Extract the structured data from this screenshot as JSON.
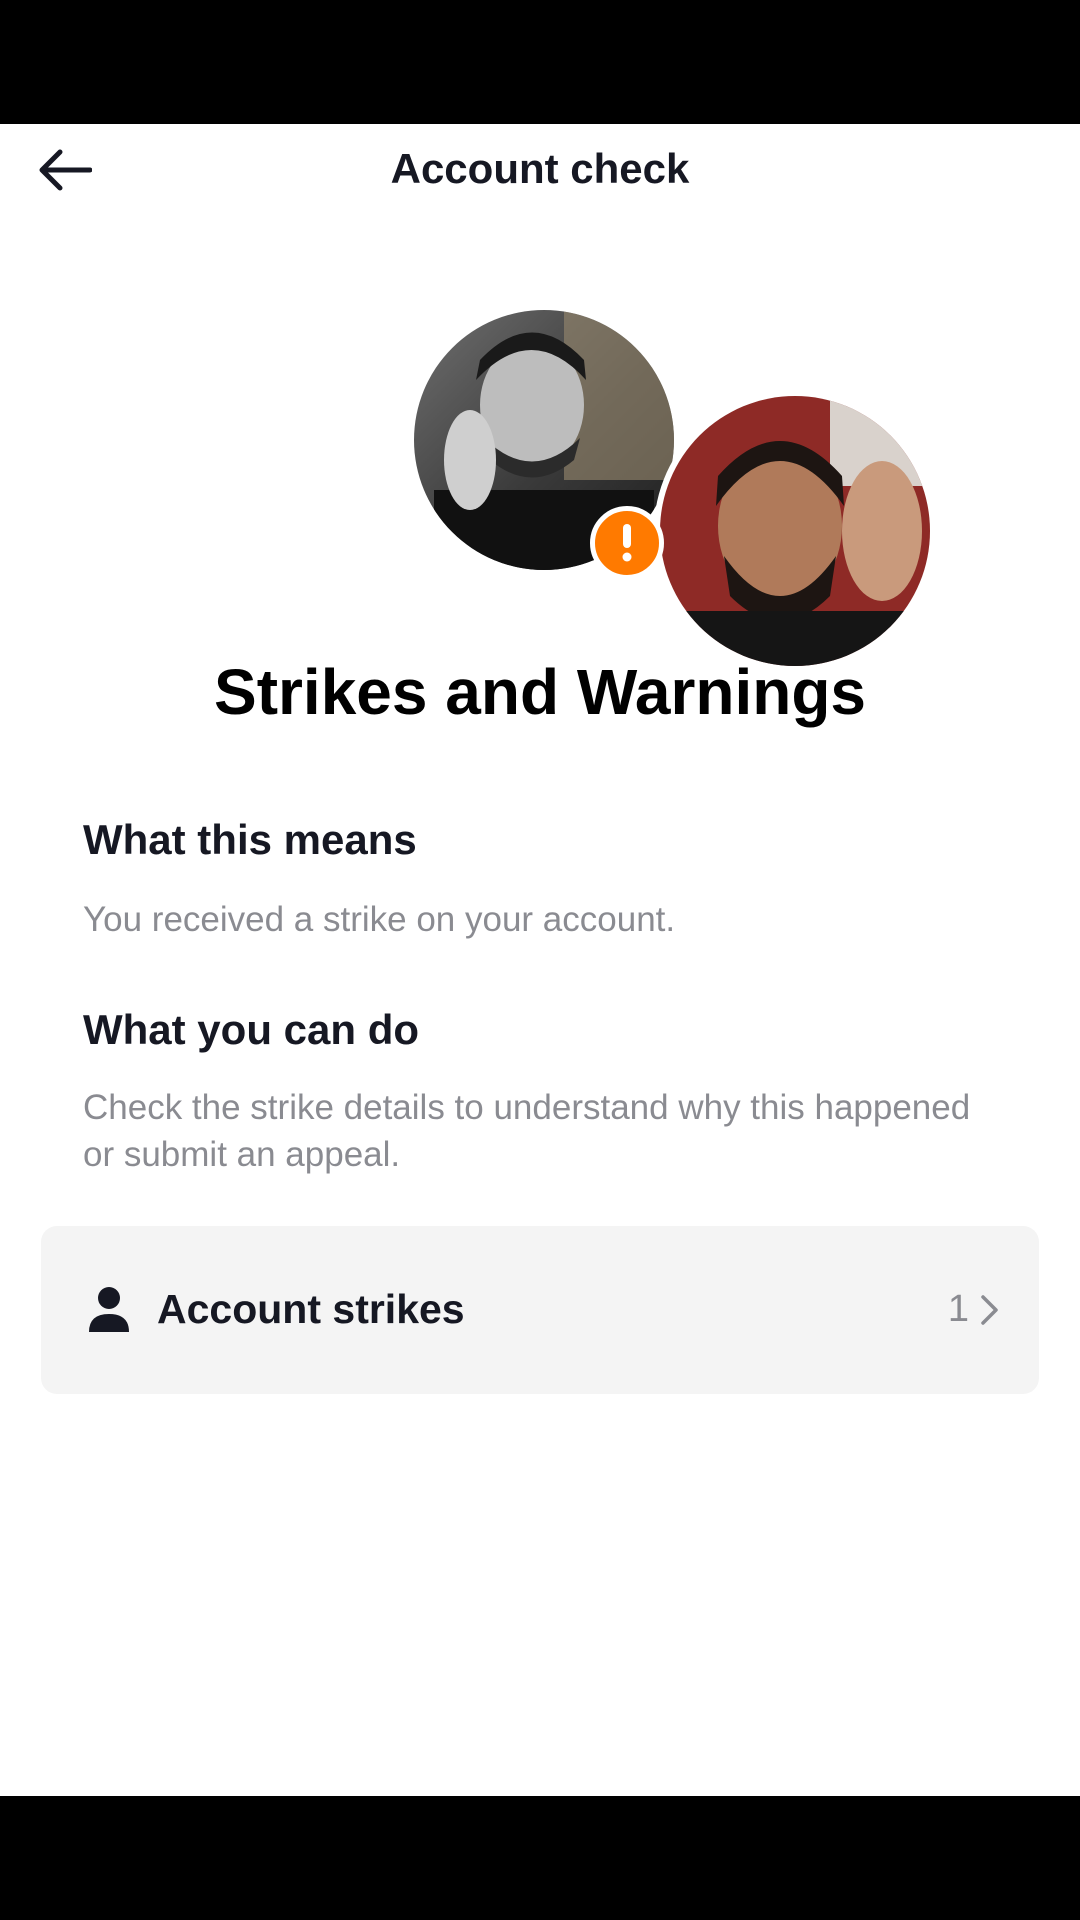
{
  "header": {
    "back_icon": "arrow-left-icon",
    "title": "Account check"
  },
  "hero": {
    "avatar_1": "user-avatar-photo",
    "avatar_2": "user-avatar-photo",
    "badge_icon": "exclamation-icon",
    "badge_color": "#ff7a00",
    "title": "Strikes and Warnings"
  },
  "sections": [
    {
      "heading": "What this means",
      "body": "You received a strike on your account."
    },
    {
      "heading": "What you can do",
      "body": "Check the strike details to understand why this happened or submit an appeal."
    }
  ],
  "strikes_card": {
    "icon": "person-icon",
    "label": "Account strikes",
    "count": "1",
    "chevron_icon": "chevron-right-icon"
  }
}
